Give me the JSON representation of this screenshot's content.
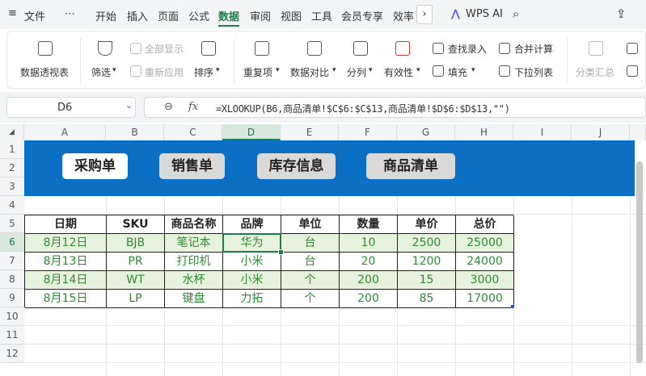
{
  "menu": {
    "file": "文件",
    "more": "⋯",
    "tabs": [
      "开始",
      "插入",
      "页面",
      "公式",
      "数据",
      "审阅",
      "视图",
      "工具",
      "会员专享",
      "效率"
    ],
    "active_tab": "数据",
    "wps_ai": "WPS AI"
  },
  "ribbon": {
    "pivot": "数据透视表",
    "filter": "筛选",
    "show_all": "全部显示",
    "reapply": "重新应用",
    "sort": "排序",
    "duplicates": "重复项",
    "compare": "数据对比",
    "split": "分列",
    "validity": "有效性",
    "find_entry": "查找录入",
    "fill": "填充",
    "merge_calc": "合并计算",
    "dropdown_list": "下拉列表",
    "subtotal": "分类汇总"
  },
  "formula_bar": {
    "cell_ref": "D6",
    "fx": "fx",
    "formula": "=XLOOKUP(B6,商品清单!$C$6:$C$13,商品清单!$D$6:$D$13,\"\")"
  },
  "columns": [
    "A",
    "B",
    "C",
    "D",
    "E",
    "F",
    "G",
    "H",
    "I",
    "J"
  ],
  "rows": [
    "1",
    "2",
    "3",
    "4",
    "5",
    "6",
    "7",
    "8",
    "9",
    "10",
    "11",
    "12"
  ],
  "nav_buttons": [
    "采购单",
    "销售单",
    "库存信息",
    "商品清单"
  ],
  "table": {
    "headers": [
      "日期",
      "SKU",
      "商品名称",
      "品牌",
      "单位",
      "数量",
      "单价",
      "总价"
    ],
    "rows": [
      [
        "8月12日",
        "BJB",
        "笔记本",
        "华为",
        "台",
        "10",
        "2500",
        "25000"
      ],
      [
        "8月13日",
        "PR",
        "打印机",
        "小米",
        "台",
        "20",
        "1200",
        "24000"
      ],
      [
        "8月14日",
        "WT",
        "水杯",
        "小米",
        "个",
        "200",
        "15",
        "3000"
      ],
      [
        "8月15日",
        "LP",
        "键盘",
        "力拓",
        "个",
        "200",
        "85",
        "17000"
      ]
    ]
  },
  "colors": {
    "accent": "#1a7d4a",
    "banner": "#0b6fc4",
    "stripe": "#e6f2dc",
    "cell_text": "#2d8a36"
  }
}
